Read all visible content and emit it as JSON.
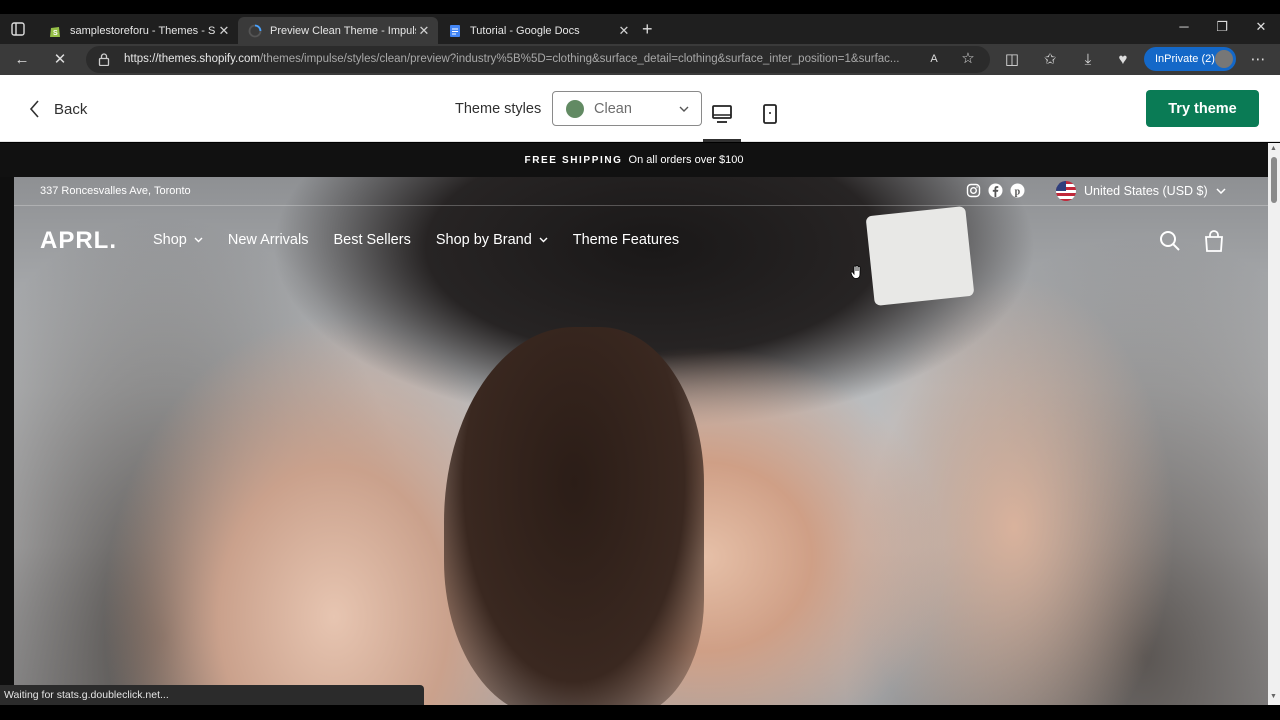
{
  "browser": {
    "tabs": [
      {
        "title": "samplestoreforu - Themes - Shop"
      },
      {
        "title": "Preview Clean Theme - Impulse"
      },
      {
        "title": "Tutorial - Google Docs"
      }
    ],
    "url_host": "https://themes.shopify.com",
    "url_path": "/themes/impulse/styles/clean/preview?industry%5B%5D=clothing&surface_detail=clothing&surface_inter_position=1&surfac...",
    "inprivate_label": "InPrivate (2)",
    "status_text": "Waiting for stats.g.doubleclick.net..."
  },
  "preview_header": {
    "back_label": "Back",
    "theme_styles_label": "Theme styles",
    "selected_style": "Clean",
    "selected_style_color": "#628a63",
    "try_theme_label": "Try theme",
    "try_theme_color": "#0a7b55"
  },
  "store": {
    "announcement_bold": "FREE SHIPPING",
    "announcement_text": "On all orders over $100",
    "address": "337 Roncesvalles Ave, Toronto",
    "locale": "United States (USD $)",
    "logo": "APRL.",
    "nav": [
      {
        "label": "Shop",
        "has_dropdown": true
      },
      {
        "label": "New Arrivals",
        "has_dropdown": false
      },
      {
        "label": "Best Sellers",
        "has_dropdown": false
      },
      {
        "label": "Shop by Brand",
        "has_dropdown": true
      },
      {
        "label": "Theme Features",
        "has_dropdown": false
      }
    ],
    "social_icons": [
      "instagram-icon",
      "facebook-icon",
      "pinterest-icon"
    ]
  }
}
